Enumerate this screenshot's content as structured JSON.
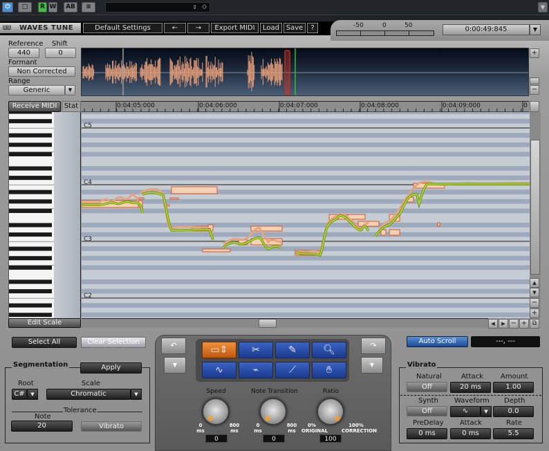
{
  "host": {
    "power_label": "⏻",
    "compare_label": "□",
    "read_label": "R",
    "write_label": "W",
    "ab_label": "AB",
    "menu_label": "≡",
    "preset_value": "",
    "collapse_icon": "▼"
  },
  "titlebar": {
    "logo": "WAVES TUNE",
    "preset": "Default Settings",
    "prev_label": "←",
    "next_label": "→",
    "export_midi": "Export MIDI",
    "load": "Load",
    "save": "Save",
    "help": "?"
  },
  "meter": {
    "labels": [
      "-50",
      "0",
      "50"
    ],
    "timecode": "0:00:49:845",
    "dropdown_icon": "▼"
  },
  "left_controls": {
    "reference_label": "Reference",
    "reference_value": "440",
    "shift_label": "Shift",
    "shift_value": "0",
    "formant_label": "Formant",
    "formant_value": "Non Corrected",
    "range_label": "Range",
    "range_value": "Generic",
    "receive_midi": "Receive MIDI",
    "stat": "Stat",
    "edit_scale": "Edit Scale"
  },
  "overview": {
    "zoom_in": "+",
    "zoom_out": "−"
  },
  "ruler": {
    "labels": [
      "0:04:05:000",
      "0:04:06:000",
      "0:04:07:000",
      "0:04:08:000",
      "0:04:09:000",
      "0"
    ]
  },
  "pitch_grid": {
    "note_labels": [
      "C5",
      "C4",
      "C3",
      "C2"
    ]
  },
  "scroll": {
    "up": "▲",
    "down": "▼",
    "v_zoom_out": "−",
    "v_zoom_in": "+",
    "left": "◀",
    "right": "▶",
    "h_zoom_out": "−",
    "h_zoom_in": "+",
    "fit": "⧉"
  },
  "selection": {
    "select_all": "Select All",
    "clear_selection": "Clear Selection"
  },
  "segmentation": {
    "title": "Segmentation",
    "apply": "Apply",
    "root_label": "Root",
    "root_value": "C#",
    "scale_label": "Scale",
    "scale_value": "Chromatic",
    "tolerance_label": "Tolerance",
    "note_label": "Note",
    "note_value": "20",
    "vibrato_button": "Vibrato"
  },
  "tools": {
    "undo": "↶",
    "redo": "↷",
    "undo_menu": "▼",
    "redo_menu": "▼",
    "items": [
      {
        "name": "segment",
        "glyph": "▭⇕",
        "active": true
      },
      {
        "name": "scissors",
        "glyph": "✂",
        "active": false
      },
      {
        "name": "pencil",
        "glyph": "✎",
        "active": false
      },
      {
        "name": "zoom",
        "glyph": "🔍︎",
        "active": false
      },
      {
        "name": "formant",
        "glyph": "∿",
        "active": false
      },
      {
        "name": "glue",
        "glyph": "⌁",
        "active": false
      },
      {
        "name": "line",
        "glyph": "⟋",
        "active": false
      },
      {
        "name": "hand",
        "glyph": "✋︎",
        "active": false
      }
    ]
  },
  "knobs": {
    "speed": {
      "label": "Speed",
      "min": "0\nms",
      "max": "800\nms",
      "value": "0"
    },
    "note_transition": {
      "label": "Note Transition",
      "min": "0\nms",
      "max": "800\nms",
      "value": "0"
    },
    "ratio": {
      "label": "Ratio",
      "min": "0%\nORIGINAL",
      "max": "100%\nCORRECTION",
      "value": "100"
    }
  },
  "autoscroll": {
    "label": "Auto Scroll",
    "readout": "---, ---"
  },
  "vibrato": {
    "title": "Vibrato",
    "natural_label": "Natural",
    "natural_value": "Off",
    "attack_label": "Attack",
    "attack_value": "20 ms",
    "amount_label": "Amount",
    "amount_value": "1.00",
    "synth_label": "Synth",
    "synth_value": "Off",
    "waveform_label": "Waveform",
    "waveform_value": "∿",
    "depth_label": "Depth",
    "depth_value": "0.0",
    "predelay_label": "PreDelay",
    "predelay_value": "0 ms",
    "synth_attack_label": "Attack",
    "synth_attack_value": "0 ms",
    "rate_label": "Rate",
    "rate_value": "5.5"
  }
}
